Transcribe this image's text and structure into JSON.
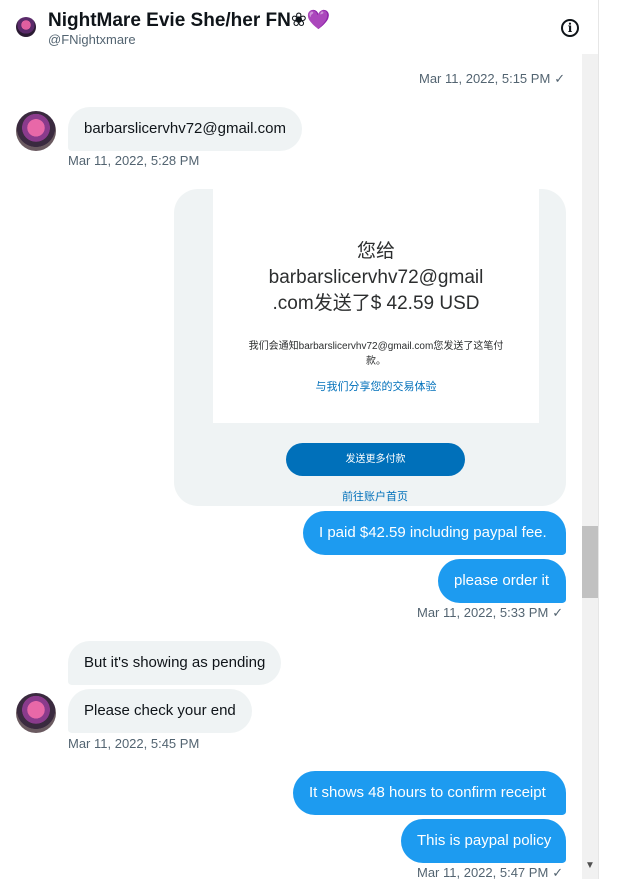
{
  "header": {
    "name": "NightMare Evie She/her FN",
    "name_emoji": "❀",
    "heart": "💜",
    "handle": "@FNightxmare",
    "info_icon": "i"
  },
  "messages": {
    "sent_top_time": "Mar 11, 2022, 5:15 PM",
    "email_msg": "barbarslicervhv72@gmail.com",
    "email_time": "Mar 11, 2022, 5:28 PM",
    "receipt": {
      "line1": "您给",
      "line2": "barbarslicervhv72@gmail",
      "line3": ".com发送了$ 42.59 USD",
      "note": "我们会通知barbarslicervhv72@gmail.com您发送了这笔付款。",
      "share_link": "与我们分享您的交易体验",
      "send_more_button": "发送更多付款",
      "account_link": "前往账户首页"
    },
    "paid_msg": "I paid $42.59 including paypal fee.",
    "order_msg": "please order it",
    "order_time": "Mar 11, 2022, 5:33 PM",
    "pending_msg": "But it's showing as pending",
    "check_msg": "Please check your end",
    "check_time": "Mar 11, 2022, 5:45 PM",
    "shows_msg": "It shows 48 hours to confirm receipt",
    "policy_msg": "This is paypal policy",
    "policy_time": "Mar 11, 2022, 5:47 PM",
    "check_mark": "✓"
  },
  "scrollbar": {
    "down_arrow": "▼"
  }
}
